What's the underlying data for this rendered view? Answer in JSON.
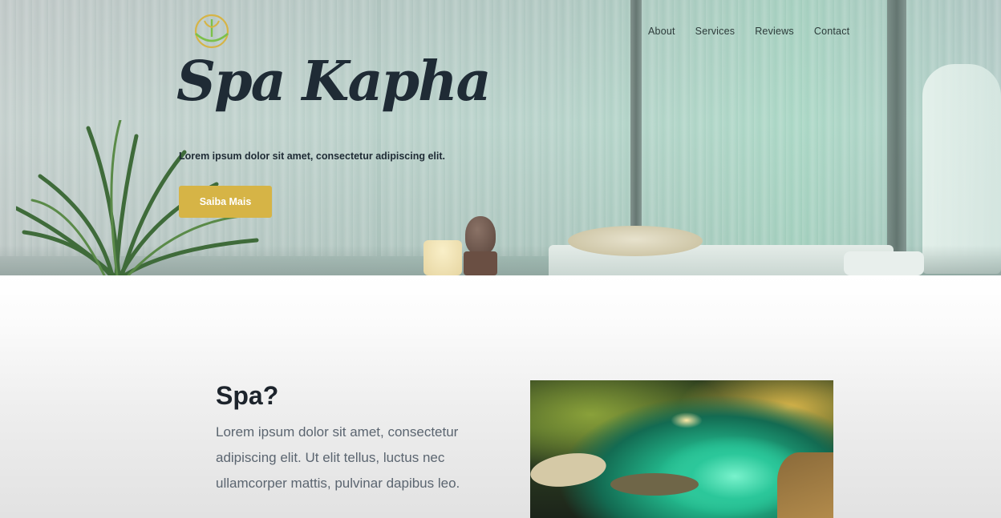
{
  "header": {
    "logo_icon": "lotus-tree-icon",
    "nav": [
      {
        "label": "About"
      },
      {
        "label": "Services"
      },
      {
        "label": "Reviews"
      },
      {
        "label": "Contact"
      }
    ]
  },
  "hero": {
    "title": "Spa Kapha",
    "tagline": "Lorem ipsum dolor sit amet, consectetur adipiscing elit.",
    "cta_label": "Saiba Mais",
    "cta_color": "#d6b446"
  },
  "section": {
    "title": "Spa?",
    "text": "Lorem ipsum dolor sit amet, consectetur adipiscing elit. Ut elit tellus, luctus nec ullamcorper mattis, pulvinar dapibus leo."
  },
  "colors": {
    "accent": "#d6b446",
    "heading": "#1d242c",
    "body_text": "#5b6570"
  }
}
